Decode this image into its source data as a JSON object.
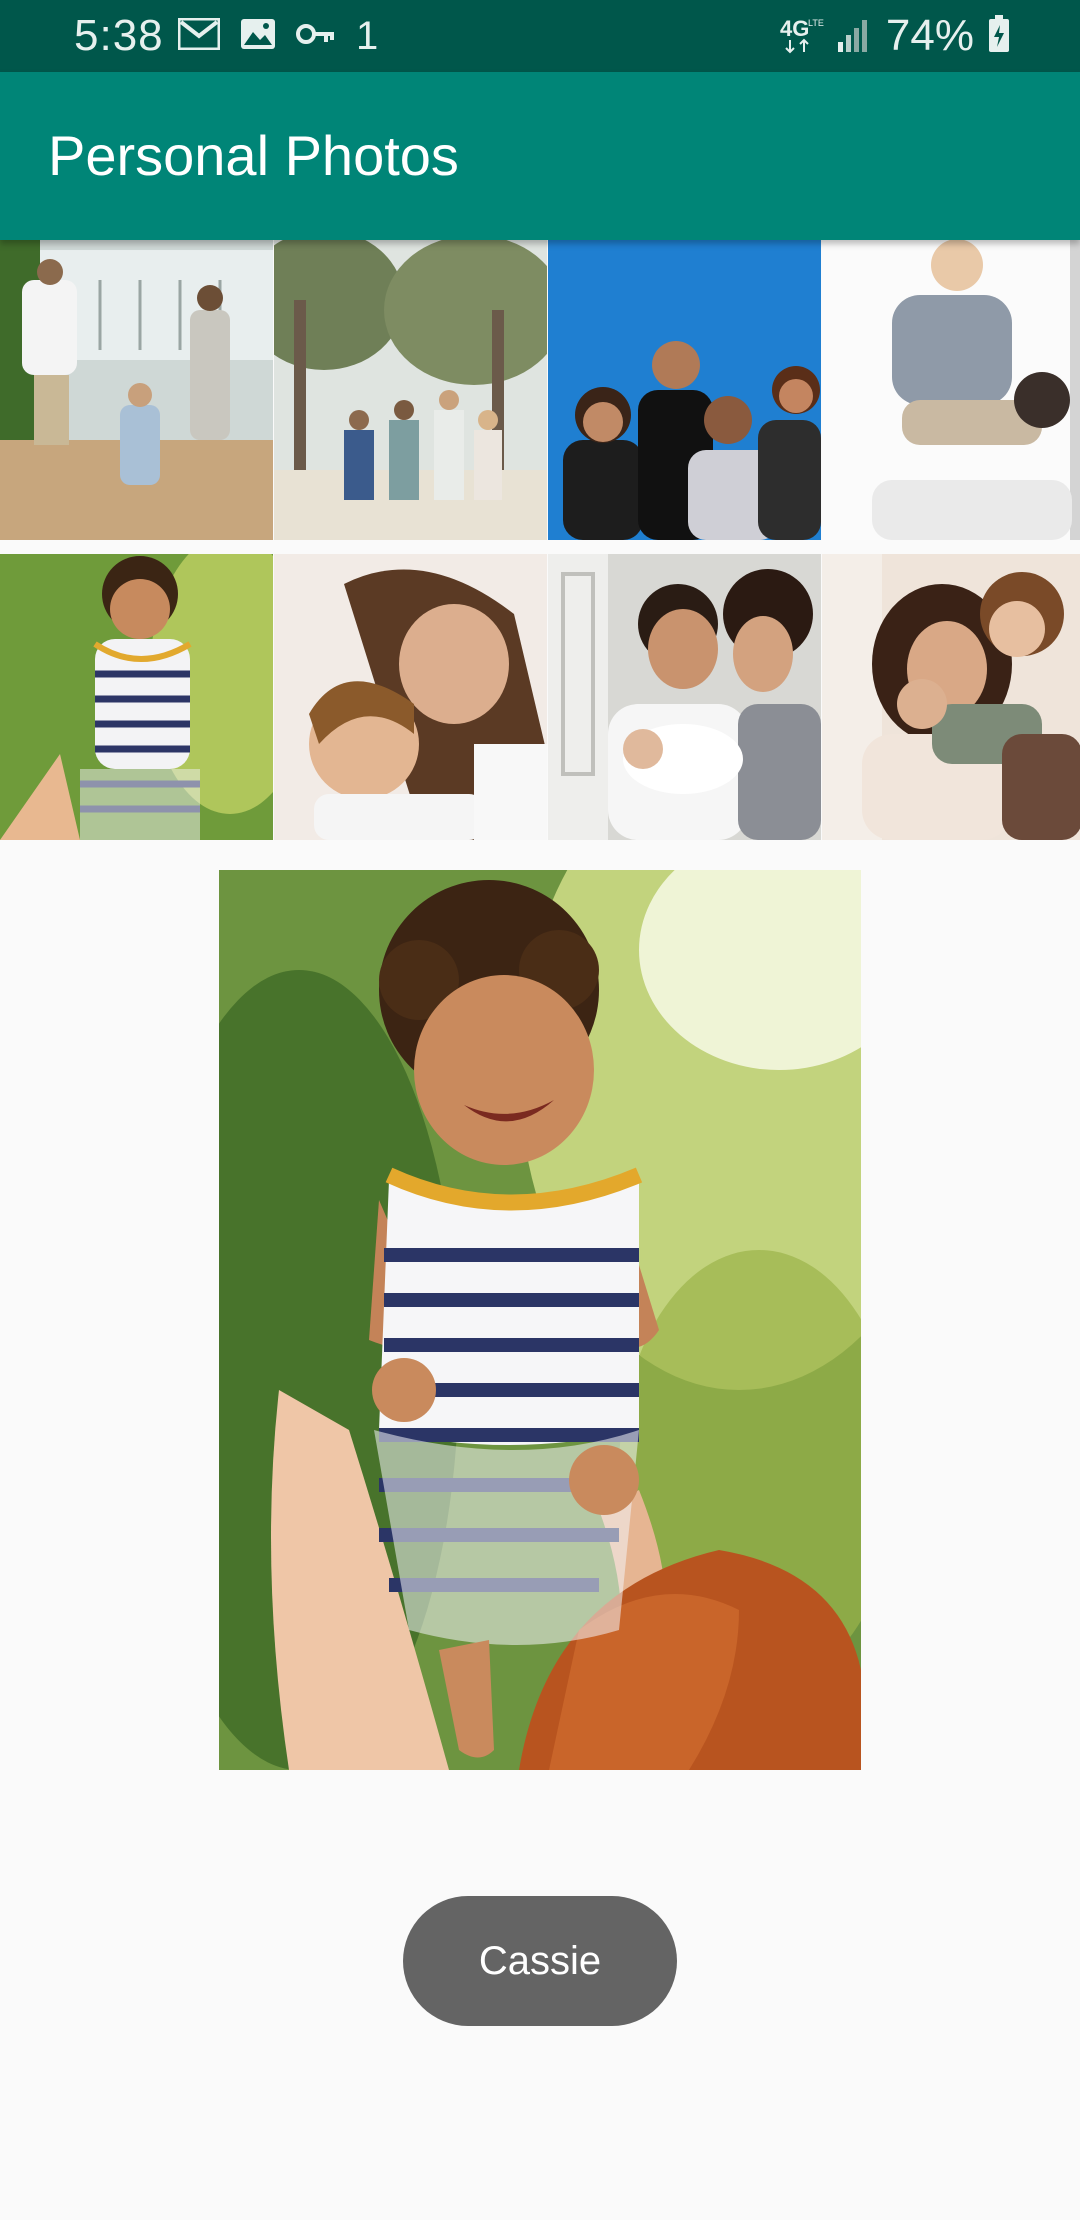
{
  "status_bar": {
    "time": "5:38",
    "notification_icons": [
      "gmail-icon",
      "image-icon",
      "key-icon",
      "notification-count-icon"
    ],
    "notification_count": "1",
    "network": "4G LTE",
    "battery_percent": "74%"
  },
  "app_bar": {
    "title": "Personal Photos",
    "color": "#008577",
    "status_color": "#00574b"
  },
  "thumbnails": [
    {
      "name": "family-walking"
    },
    {
      "name": "family-under-trees"
    },
    {
      "name": "family-blue-backdrop"
    },
    {
      "name": "child-on-shoulders"
    },
    {
      "name": "laughing-toddler"
    },
    {
      "name": "mother-and-son"
    },
    {
      "name": "parents-with-newborn"
    },
    {
      "name": "mother-with-kids"
    }
  ],
  "preview": {
    "subject": "laughing-toddler"
  },
  "toast": {
    "text": "Cassie"
  }
}
